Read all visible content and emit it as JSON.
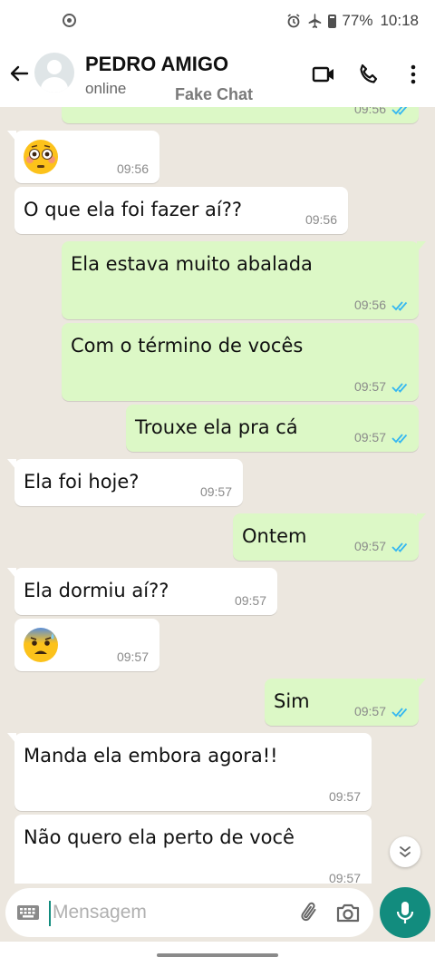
{
  "status_bar": {
    "battery": "77%",
    "time": "10:18"
  },
  "header": {
    "contact_name": "PEDRO AMIGO",
    "contact_status": "online",
    "watermark": "Fake Chat"
  },
  "messages": [
    {
      "direction": "out",
      "type": "text",
      "text": "",
      "time": "09:56",
      "read": true,
      "partial": true
    },
    {
      "direction": "in",
      "type": "emoji",
      "emoji": "flushed-face",
      "time": "09:56"
    },
    {
      "direction": "in",
      "type": "text",
      "text": "O que ela foi fazer aí??",
      "time": "09:56"
    },
    {
      "direction": "out",
      "type": "text",
      "text": "Ela estava muito abalada",
      "time": "09:56",
      "read": true
    },
    {
      "direction": "out",
      "type": "text",
      "text": "Com o término de vocês",
      "time": "09:57",
      "read": true
    },
    {
      "direction": "out",
      "type": "text",
      "text": "Trouxe ela pra cá",
      "time": "09:57",
      "read": true
    },
    {
      "direction": "in",
      "type": "text",
      "text": "Ela foi hoje?",
      "time": "09:57"
    },
    {
      "direction": "out",
      "type": "text",
      "text": "Ontem",
      "time": "09:57",
      "read": true
    },
    {
      "direction": "in",
      "type": "text",
      "text": "Ela dormiu aí??",
      "time": "09:57"
    },
    {
      "direction": "in",
      "type": "emoji",
      "emoji": "anxious-face-with-sweat",
      "time": "09:57"
    },
    {
      "direction": "out",
      "type": "text",
      "text": "Sim",
      "time": "09:57",
      "read": true
    },
    {
      "direction": "in",
      "type": "text",
      "text": "Manda ela embora agora!!",
      "time": "09:57"
    },
    {
      "direction": "in",
      "type": "text",
      "text": "Não quero ela perto de você",
      "time": "09:57",
      "partial": true
    }
  ],
  "composer": {
    "placeholder": "Mensagem"
  },
  "colors": {
    "accent": "#128c7e",
    "outgoing_bubble": "#dcf8c6",
    "incoming_bubble": "#ffffff",
    "chat_background": "#ece7df",
    "read_ticks": "#34b7f1"
  }
}
